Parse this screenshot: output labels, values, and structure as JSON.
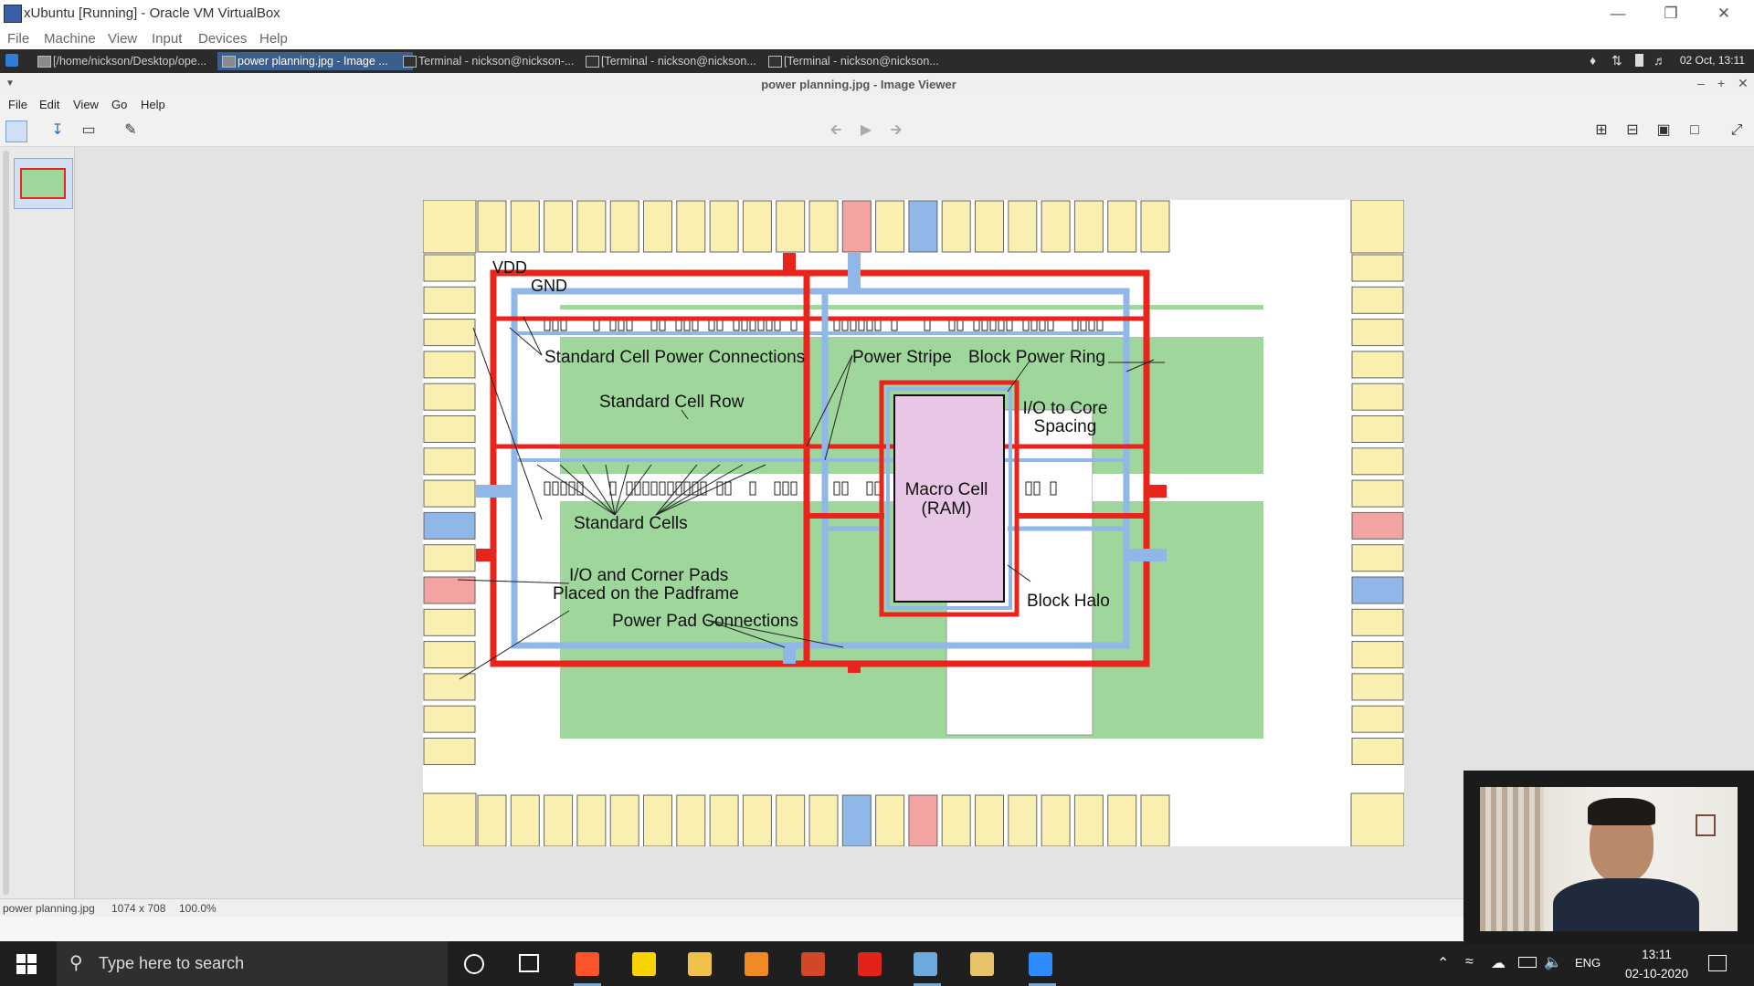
{
  "vbox": {
    "title": "xUbuntu [Running] - Oracle VM VirtualBox",
    "menu": [
      "File",
      "Machine",
      "View",
      "Input",
      "Devices",
      "Help"
    ]
  },
  "xfce_panel": {
    "tasks": [
      "[/home/nickson/Desktop/ope...",
      "power planning.jpg - Image ...",
      "Terminal - nickson@nickson-...",
      "[Terminal - nickson@nickson...",
      "[Terminal - nickson@nickson..."
    ],
    "clock": "02 Oct, 13:11"
  },
  "viewer": {
    "title": "power planning.jpg - Image Viewer",
    "menu": [
      "File",
      "Edit",
      "View",
      "Go",
      "Help"
    ],
    "status": {
      "filename": "power planning.jpg",
      "dimensions": "1074 x 708",
      "zoom": "100.0%"
    }
  },
  "diagram": {
    "vdd": "VDD",
    "gnd": "GND",
    "std_cell_power": "Standard Cell Power Connections",
    "power_stripe": "Power Stripe",
    "block_power_ring": "Block Power Ring",
    "std_cell_row": "Standard Cell Row",
    "io_core_1": "I/O to Core",
    "io_core_2": "Spacing",
    "macro_1": "Macro Cell",
    "macro_2": "(RAM)",
    "std_cells": "Standard Cells",
    "io_pads_1": "I/O and Corner Pads",
    "io_pads_2": "Placed on the Padframe",
    "block_halo": "Block Halo",
    "power_pad": "Power Pad Connections"
  },
  "taskbar": {
    "search_placeholder": "Type here to search",
    "lang": "ENG",
    "time": "13:11",
    "date": "02-10-2020"
  },
  "colors": {
    "pad": "#f8efb0",
    "vdd": "#e8241c",
    "gnd": "#8fb8e8",
    "core": "#9fd69b",
    "macro": "#e8c6e6",
    "panel": "#2b2b2b",
    "taskbar": "#1f1f1f"
  }
}
